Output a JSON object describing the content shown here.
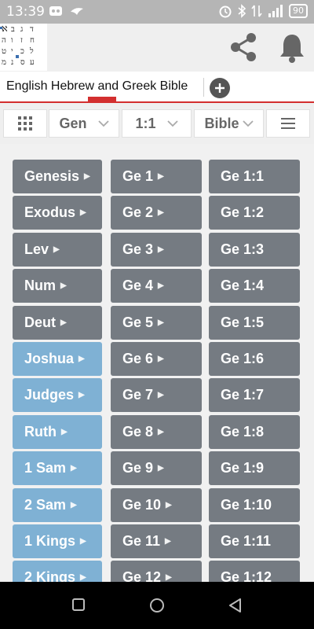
{
  "status": {
    "time": "13:39",
    "battery": "90",
    "network": "3G"
  },
  "tab": {
    "label": "English Hebrew and Greek Bible"
  },
  "toolbar": {
    "book": "Gen",
    "verse": "1:1",
    "bible": "Bible"
  },
  "books": [
    {
      "label": "Genesis",
      "group": "law"
    },
    {
      "label": "Exodus",
      "group": "law"
    },
    {
      "label": "Lev",
      "group": "law"
    },
    {
      "label": "Num",
      "group": "law"
    },
    {
      "label": "Deut",
      "group": "law"
    },
    {
      "label": "Joshua",
      "group": "history"
    },
    {
      "label": "Judges",
      "group": "history"
    },
    {
      "label": "Ruth",
      "group": "history"
    },
    {
      "label": "1 Sam",
      "group": "history"
    },
    {
      "label": "2 Sam",
      "group": "history"
    },
    {
      "label": "1 Kings",
      "group": "history"
    },
    {
      "label": "2 Kings",
      "group": "history"
    }
  ],
  "chapters": [
    "Ge 1",
    "Ge 2",
    "Ge 3",
    "Ge 4",
    "Ge 5",
    "Ge 6",
    "Ge 7",
    "Ge 8",
    "Ge 9",
    "Ge 10",
    "Ge 11",
    "Ge 12"
  ],
  "verses": [
    "Ge 1:1",
    "Ge 1:2",
    "Ge 1:3",
    "Ge 1:4",
    "Ge 1:5",
    "Ge 1:6",
    "Ge 1:7",
    "Ge 1:8",
    "Ge 1:9",
    "Ge 1:10",
    "Ge 1:11",
    "Ge 1:12"
  ],
  "colors": {
    "accent": "#d32f2f",
    "button_gray": "#757b82",
    "button_blue": "#7fb1d4"
  },
  "icons": {
    "share": "share-icon",
    "bell": "bell-icon",
    "add": "plus-icon",
    "grid": "grid-icon",
    "menu": "hamburger-icon"
  }
}
